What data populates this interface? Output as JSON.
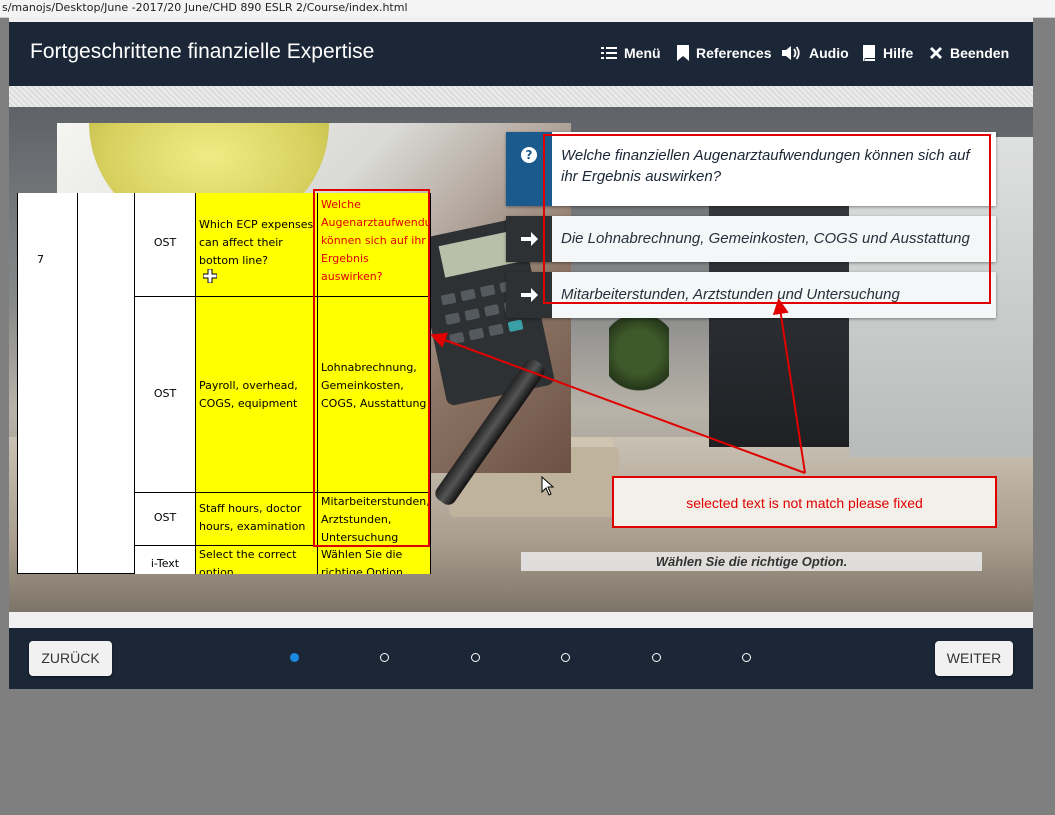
{
  "address_bar": {
    "path": "s/manojs/Desktop/June -2017/20 June/CHD 890 ESLR 2/Course/index.html"
  },
  "header": {
    "title": "Fortgeschrittene finanzielle Expertise",
    "nav": [
      {
        "label": "Menü",
        "icon": "menu-icon"
      },
      {
        "label": "References",
        "icon": "bookmark-icon"
      },
      {
        "label": "Audio",
        "icon": "speaker-icon"
      },
      {
        "label": "Hilfe",
        "icon": "book-icon"
      },
      {
        "label": "Beenden",
        "icon": "close-icon"
      }
    ]
  },
  "question": {
    "icon": "question-icon",
    "text": "Welche finanziellen Augenarztaufwendungen können sich auf ihr Ergebnis auswirken?",
    "options": [
      {
        "text": "Die Lohnabrechnung, Gemeinkosten, COGS und Ausstattung",
        "icon": "arrow-right-icon"
      },
      {
        "text": "Mitarbeiterstunden, Arztstunden und Untersuchung",
        "icon": "arrow-right-icon"
      }
    ],
    "instruction": "Wählen Sie die richtige Option."
  },
  "table": {
    "rows": [
      {
        "num": "7",
        "type": "OST",
        "english": "Which ECP expenses can affect their bottom line?",
        "german": "Welche Augenarztaufwendungen können sich auf ihr Ergebnis auswirken?"
      },
      {
        "num": "",
        "type": "OST",
        "english": "Payroll, overhead, COGS, equipment",
        "german": "Lohnabrechnung, Gemeinkosten, COGS, Ausstattung"
      },
      {
        "num": "",
        "type": "OST",
        "english": "Staff hours, doctor hours, examination",
        "german": "Mitarbeiterstunden, Arztstunden, Untersuchung"
      },
      {
        "num": "",
        "type": "i-Text",
        "english": "Select the correct option",
        "german": "Wählen Sie die richtige Option"
      }
    ]
  },
  "annotation": {
    "note": "selected text is not match please fixed",
    "color": "#e00000"
  },
  "footer": {
    "back_label": "ZURÜCK",
    "next_label": "WEITER",
    "pages": 6,
    "current_page": 1
  },
  "colors": {
    "header_bg": "#1b2636",
    "accent": "#1b5a8c",
    "dot_active": "#1b8be0",
    "highlight": "#ffff00"
  }
}
